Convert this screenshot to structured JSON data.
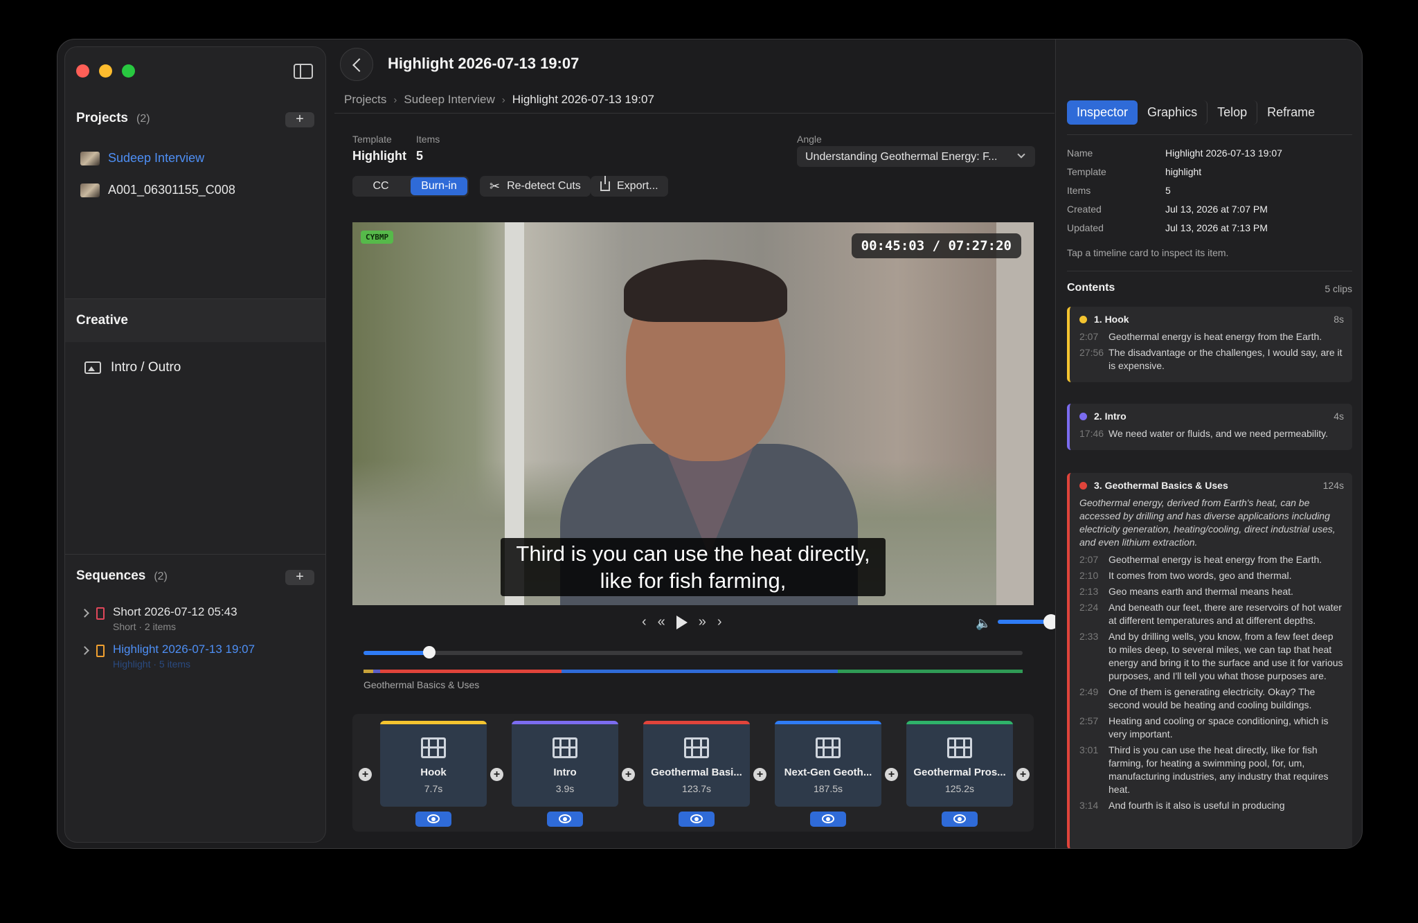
{
  "window": {
    "title": "Highlight 2026-07-13 19:07"
  },
  "sidebar": {
    "projects": {
      "title": "Projects",
      "count": "(2)",
      "add": "+",
      "items": [
        {
          "label": "Sudeep Interview"
        },
        {
          "label": "A001_06301155_C008"
        }
      ]
    },
    "creative": {
      "title": "Creative",
      "items": [
        {
          "label": "Intro / Outro",
          "icon": "photo-icon"
        }
      ]
    },
    "sequences": {
      "title": "Sequences",
      "count": "(2)",
      "add": "+",
      "items": [
        {
          "title": "Short 2026-07-12 05:43",
          "subtitle": "Short · 2 items",
          "color": "#e0475a"
        },
        {
          "title": "Highlight 2026-07-13 19:07",
          "subtitle": "Highlight · 5 items",
          "color": "#f0a030"
        }
      ]
    }
  },
  "breadcrumb": {
    "items": [
      "Projects",
      "Sudeep Interview",
      "Highlight 2026-07-13 19:07"
    ]
  },
  "meta": {
    "template_label": "Template",
    "template_value": "Highlight",
    "items_label": "Items",
    "items_value": "5",
    "angle_label": "Angle",
    "angle_value": "Understanding Geothermal Energy: F..."
  },
  "toolbar": {
    "cc": "CC",
    "burnin": "Burn-in",
    "redetect": "Re-detect Cuts",
    "export": "Export..."
  },
  "video": {
    "tag": "CYBMP",
    "timecode": "00:45:03 / 07:27:20",
    "subtitle_line1": "Third is you can use the heat directly,",
    "subtitle_line2": "like for fish farming,",
    "volume_level": 0.8,
    "playhead_fraction": 0.1
  },
  "timeline": {
    "current_segment": "Geothermal Basics & Uses",
    "segments": [
      {
        "color": "#c8a23a",
        "fraction": 0.015
      },
      {
        "color": "#5a5fc8",
        "fraction": 0.01
      },
      {
        "color": "#e0443b",
        "fraction": 0.275
      },
      {
        "color": "#2f6bd8",
        "fraction": 0.42
      },
      {
        "color": "#2f9a55",
        "fraction": 0.28
      }
    ],
    "clips": [
      {
        "name": "Hook",
        "duration": "7.7s",
        "color": "#f4c430"
      },
      {
        "name": "Intro",
        "duration": "3.9s",
        "color": "#7b6cf0"
      },
      {
        "name": "Geothermal Basi...",
        "duration": "123.7s",
        "color": "#e0443b"
      },
      {
        "name": "Next-Gen Geoth...",
        "duration": "187.5s",
        "color": "#2f7cf6"
      },
      {
        "name": "Geothermal Pros...",
        "duration": "125.2s",
        "color": "#2fb36a"
      }
    ]
  },
  "inspector": {
    "tabs": [
      "Inspector",
      "Graphics",
      "Telop",
      "Reframe"
    ],
    "fields": [
      {
        "k": "Name",
        "v": "Highlight 2026-07-13 19:07"
      },
      {
        "k": "Template",
        "v": "highlight"
      },
      {
        "k": "Items",
        "v": "5"
      },
      {
        "k": "Created",
        "v": "Jul 13, 2026 at 7:07 PM"
      },
      {
        "k": "Updated",
        "v": "Jul 13, 2026 at 7:13 PM"
      }
    ],
    "hint": "Tap a timeline card to inspect its item.",
    "contents_title": "Contents",
    "contents_count": "5 clips",
    "cards": [
      {
        "title": "1. Hook",
        "dur": "8s",
        "color": "#f4c430",
        "lines": [
          {
            "ts": "2:07",
            "text": "Geothermal energy is heat energy from the Earth."
          },
          {
            "ts": "27:56",
            "text": "The disadvantage or the challenges, I would say, are it is expensive."
          }
        ]
      },
      {
        "title": "2. Intro",
        "dur": "4s",
        "color": "#7b6cf0",
        "lines": [
          {
            "ts": "17:46",
            "text": "We need water or fluids, and we need permeability."
          }
        ]
      },
      {
        "title": "3. Geothermal Basics & Uses",
        "dur": "124s",
        "color": "#e0443b",
        "summary": "Geothermal energy, derived from Earth's heat, can be accessed by drilling and has diverse applications including electricity generation, heating/cooling, direct industrial uses, and even lithium extraction.",
        "lines": [
          {
            "ts": "2:07",
            "text": "Geothermal energy is heat energy from the Earth."
          },
          {
            "ts": "2:10",
            "text": "It comes from two words, geo and thermal."
          },
          {
            "ts": "2:13",
            "text": "Geo means earth and thermal means heat."
          },
          {
            "ts": "2:24",
            "text": "And beneath our feet, there are reservoirs of hot water at different temperatures and at different depths."
          },
          {
            "ts": "2:33",
            "text": "And by drilling wells, you know, from a few feet deep to miles deep, to several miles, we can tap that heat energy and bring it to the surface and use it for various purposes, and I'll tell you what those purposes are."
          },
          {
            "ts": "2:49",
            "text": "One of them is generating electricity. Okay? The second would be heating and cooling buildings."
          },
          {
            "ts": "2:57",
            "text": "Heating and cooling or space conditioning, which is very important."
          },
          {
            "ts": "3:01",
            "text": "Third is you can use the heat directly, like for fish farming, for heating a swimming pool, for, um, manufacturing industries, any industry that requires heat."
          },
          {
            "ts": "3:14",
            "text": "And fourth is it also is useful in producing"
          }
        ]
      }
    ]
  }
}
